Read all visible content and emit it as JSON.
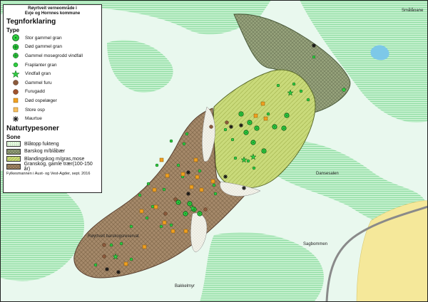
{
  "title": {
    "line1": "Røyrtveit verneområde i",
    "line2": "Evje og Hornnes kommune"
  },
  "legend": {
    "heading": "Tegnforklaring",
    "type_heading": "Type",
    "types": [
      {
        "label": "Stor gammel gran",
        "icon": "big-old-spruce-icon",
        "color": "#2ecc40"
      },
      {
        "label": "Død gammel gran",
        "icon": "dead-old-spruce-icon",
        "color": "#2ecc40"
      },
      {
        "label": "Gammel mosegrodd vindfall",
        "icon": "mossy-windfall-icon",
        "color": "#2ecc40"
      },
      {
        "label": "Fraplanter gran",
        "icon": "spruce-seedlings-icon",
        "color": "#2ecc40"
      },
      {
        "label": "Vindfall gran",
        "icon": "spruce-windfall-icon",
        "color": "#2ecc40"
      },
      {
        "label": "Gammel furu",
        "icon": "old-pine-icon",
        "color": "#8b5a3c"
      },
      {
        "label": "Furugadd",
        "icon": "pine-snag-icon",
        "color": "#8b5a3c"
      },
      {
        "label": "Død ospelæger",
        "icon": "dead-aspen-log-icon",
        "color": "#f0a020"
      },
      {
        "label": "Store osp",
        "icon": "large-aspen-icon",
        "color": "#f0a020"
      },
      {
        "label": "Maurtue",
        "icon": "anthill-icon",
        "color": "#111111"
      }
    ],
    "naturtyper_heading": "Naturtypesoner",
    "sone_heading": "Sone",
    "zones": [
      {
        "label": "Blåtopp fukteng",
        "color": "#d8f0d0"
      },
      {
        "label": "Barskog m/blåbær",
        "color": "#8a9a70"
      },
      {
        "label": "Blandingskog m/gras,mose",
        "color": "#c8d878"
      },
      {
        "label": "Granskog, gamle trær(100-150 år)",
        "color": "#a08868"
      }
    ],
    "credit": "Fylkesmannen i Aust- og Vest-Agder, sept. 2016"
  },
  "places": {
    "smaldoane": "Smålåoane",
    "dansesalen": "Dansesalen",
    "saglbommen": "Sagbommen",
    "royrtveit_berskogsreservat": "Røyrtveit barskogsreservat",
    "bakkelmyr": "Bakkelmyr"
  },
  "colors": {
    "background_light": "#e8f7ec",
    "open_green": "#a8e8b8",
    "road": "#8a8a8a",
    "yellow_field": "#f5e89a",
    "water": "#7dc8e8"
  }
}
